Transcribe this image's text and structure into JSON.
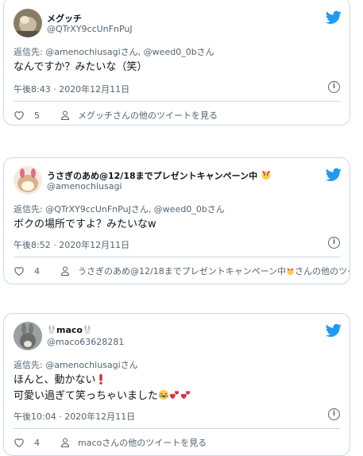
{
  "tweets": [
    {
      "username": "メグッチ",
      "handle": "@QTrXY9ccUnFnPuJ",
      "reply_prefix": "返信先: ",
      "reply_to": "@amenochiusagiさん, @weed0_0bさん",
      "text_lines": [
        "なんですか？みたいな（笑）"
      ],
      "timestamp": "午後8:43 · 2020年12月11日",
      "likes": "5",
      "more_link": "メグッチさんの他のツイートを見る"
    },
    {
      "username": "うさぎのあめ@12/18までプレゼントキャンペーン中",
      "handle": "@amenochiusagi",
      "reply_prefix": "返信先: ",
      "reply_to": "@QTrXY9ccUnFnPuJさん, @weed0_0bさん",
      "text_lines": [
        "ボクの場所ですよ？みたいなw"
      ],
      "timestamp": "午後8:52 · 2020年12月11日",
      "likes": "4",
      "more_link": "うさぎのあめ@12/18までプレゼントキャンペーン中",
      "more_link_suffix": "さんの他のツイ…"
    },
    {
      "username": "maco",
      "handle": "@maco63628281",
      "reply_prefix": "返信先: ",
      "reply_to": "@amenochiusagiさん",
      "text_lines": [
        "ほんと、動かない",
        "可愛い過ぎて笑っちゃいました"
      ],
      "timestamp": "午後10:04 · 2020年12月11日",
      "likes": "4",
      "more_link": "macoさんの他のツイートを見る"
    }
  ],
  "icons": {
    "brand": "twitter-bird-icon",
    "like": "heart-icon",
    "profile": "person-icon",
    "info": "info-icon"
  },
  "colors": {
    "brand": "#1d9bf0",
    "text": "#0f1419",
    "muted": "#536471",
    "border": "#cfd9de"
  }
}
